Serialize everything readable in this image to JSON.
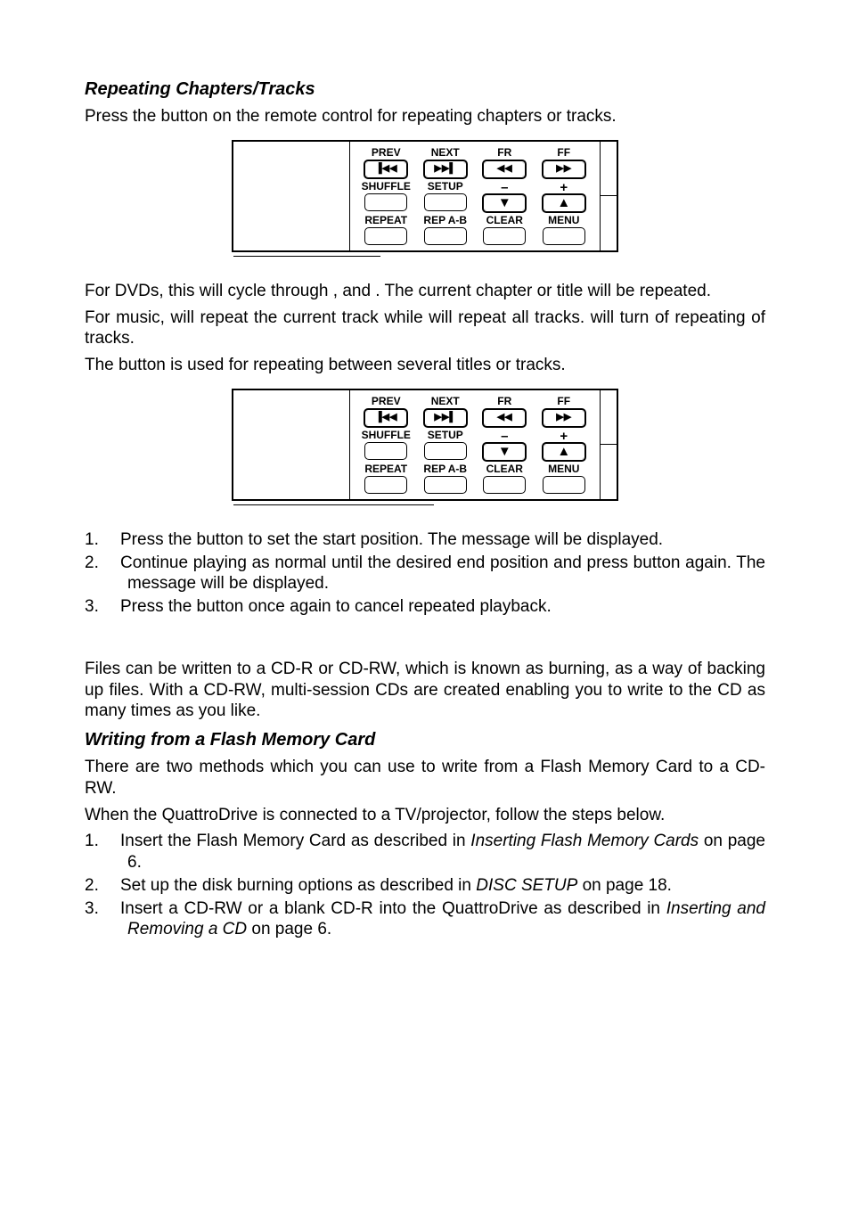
{
  "section1": {
    "heading": "Repeating Chapters/Tracks",
    "p1a": "Press the ",
    "p1b": " button on the remote control for repeating chapters or tracks.",
    "p2a": "For DVDs, this will cycle through ",
    "p2b": ", ",
    "p2c": " and ",
    "p2d": ".  The current chapter or title will be repeated.",
    "p3a": "For music, ",
    "p3b": " will repeat the current track while ",
    "p3c": " will repeat all tracks.  ",
    "p3d": " will turn of repeating of tracks.",
    "p4a": "The ",
    "p4b": " button is used for repeating between several titles or tracks.",
    "li1a": "Press the ",
    "li1b": " button to set the start position.  The ",
    "li1c": " message will be displayed.",
    "li2a": "Continue playing as normal until the desired end position and press ",
    "li2b": " button again.  The ",
    "li2c": " message will be displayed.",
    "li3a": "Press the ",
    "li3b": " button once again to cancel repeated playback."
  },
  "section2": {
    "p1": "Files can be written to a CD-R or CD-RW, which is known as burning, as a way of backing up files.  With a CD-RW, multi-session CDs are created enabling you to write to the CD as many times as you like.",
    "heading": "Writing from a Flash Memory Card",
    "p2": "There are two methods which you can use to write from a Flash Memory Card to a CD-RW.",
    "p3": "When the QuattroDrive is connected to a TV/projector, follow the steps below.",
    "li1a": "Insert the Flash Memory Card as described in ",
    "li1i": "Inserting Flash Memory Cards",
    "li1b": " on page 6.",
    "li2a": "Set up the disk burning options as described in ",
    "li2i": "DISC SETUP",
    "li2b": " on page 18.",
    "li3a": "Insert a CD-RW or a blank CD-R into the QuattroDrive as described in ",
    "li3i": "Inserting and Removing a CD",
    "li3b": " on page 6."
  },
  "remote": {
    "prev": "PREV",
    "next": "NEXT",
    "fr": "FR",
    "ff": "FF",
    "shuffle": "SHUFFLE",
    "setup": "SETUP",
    "minus": "–",
    "plus": "+",
    "repeat": "REPEAT",
    "repab": "REP A-B",
    "clear": "CLEAR",
    "menu": "MENU"
  },
  "nums": {
    "n1": "1.",
    "n2": "2.",
    "n3": "3."
  }
}
